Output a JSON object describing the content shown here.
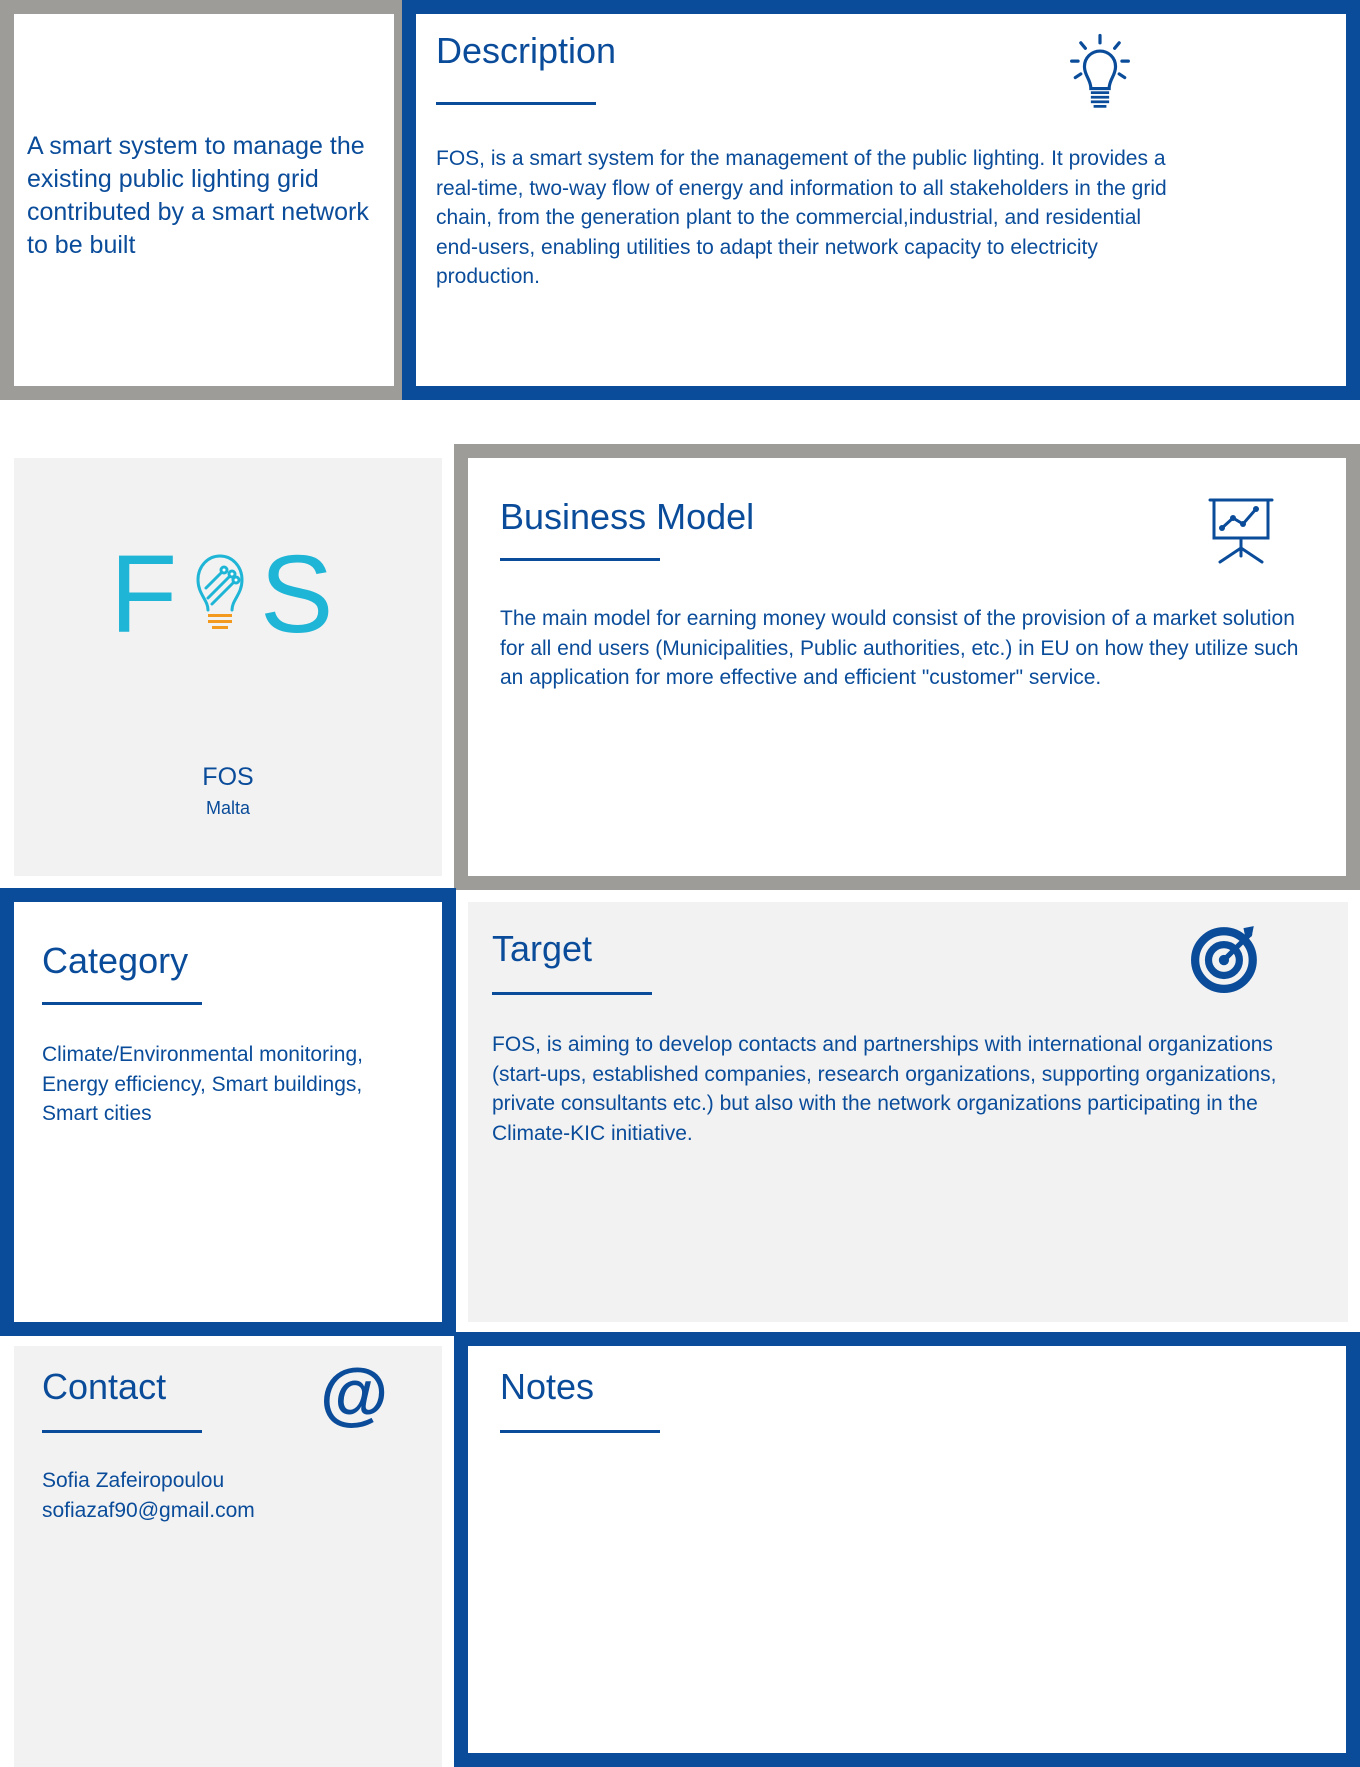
{
  "tagline": "A smart system to manage the existing public lighting grid contributed by a smart network to be built",
  "description": {
    "title": "Description",
    "icon": "lightbulb-icon",
    "text": "FOS, is a smart system for the management of the public lighting. It provides a real-time, two-way flow of energy and information to all stakeholders in the grid chain, from the generation plant to the commercial,industrial, and residential end-users, enabling utilities to adapt their network capacity to electricity production."
  },
  "company": {
    "logo_letters": {
      "first": "F",
      "last": "S"
    },
    "name": "FOS",
    "country": "Malta"
  },
  "business_model": {
    "title": "Business Model",
    "icon": "presentation-chart-icon",
    "text": "The main model for earning money would consist of the provision of a market solution for all end users (Municipalities, Public authorities, etc.) in EU on how they utilize such an application for more effective and efficient \"customer\" service."
  },
  "category": {
    "title": "Category",
    "text": "Climate/Environmental monitoring, Energy efficiency, Smart buildings, Smart cities"
  },
  "target": {
    "title": "Target",
    "icon": "target-icon",
    "text": "FOS, is aiming to develop contacts and partnerships with international organizations (start-ups, established companies, research organizations, supporting organizations, private consultants etc.) but also with the network organizations participating in the Climate-KIC initiative."
  },
  "contact": {
    "title": "Contact",
    "icon": "at-sign-icon",
    "name": "Sofia Zafeiropoulou",
    "email": "sofiazaf90@gmail.com"
  },
  "notes": {
    "title": "Notes",
    "text": ""
  },
  "colors": {
    "accent": "#0a4c9a",
    "gray_border": "#9e9c99",
    "panel": "#f2f2f2",
    "logo_cyan": "#1fb5d6",
    "logo_orange": "#f39a1e"
  }
}
